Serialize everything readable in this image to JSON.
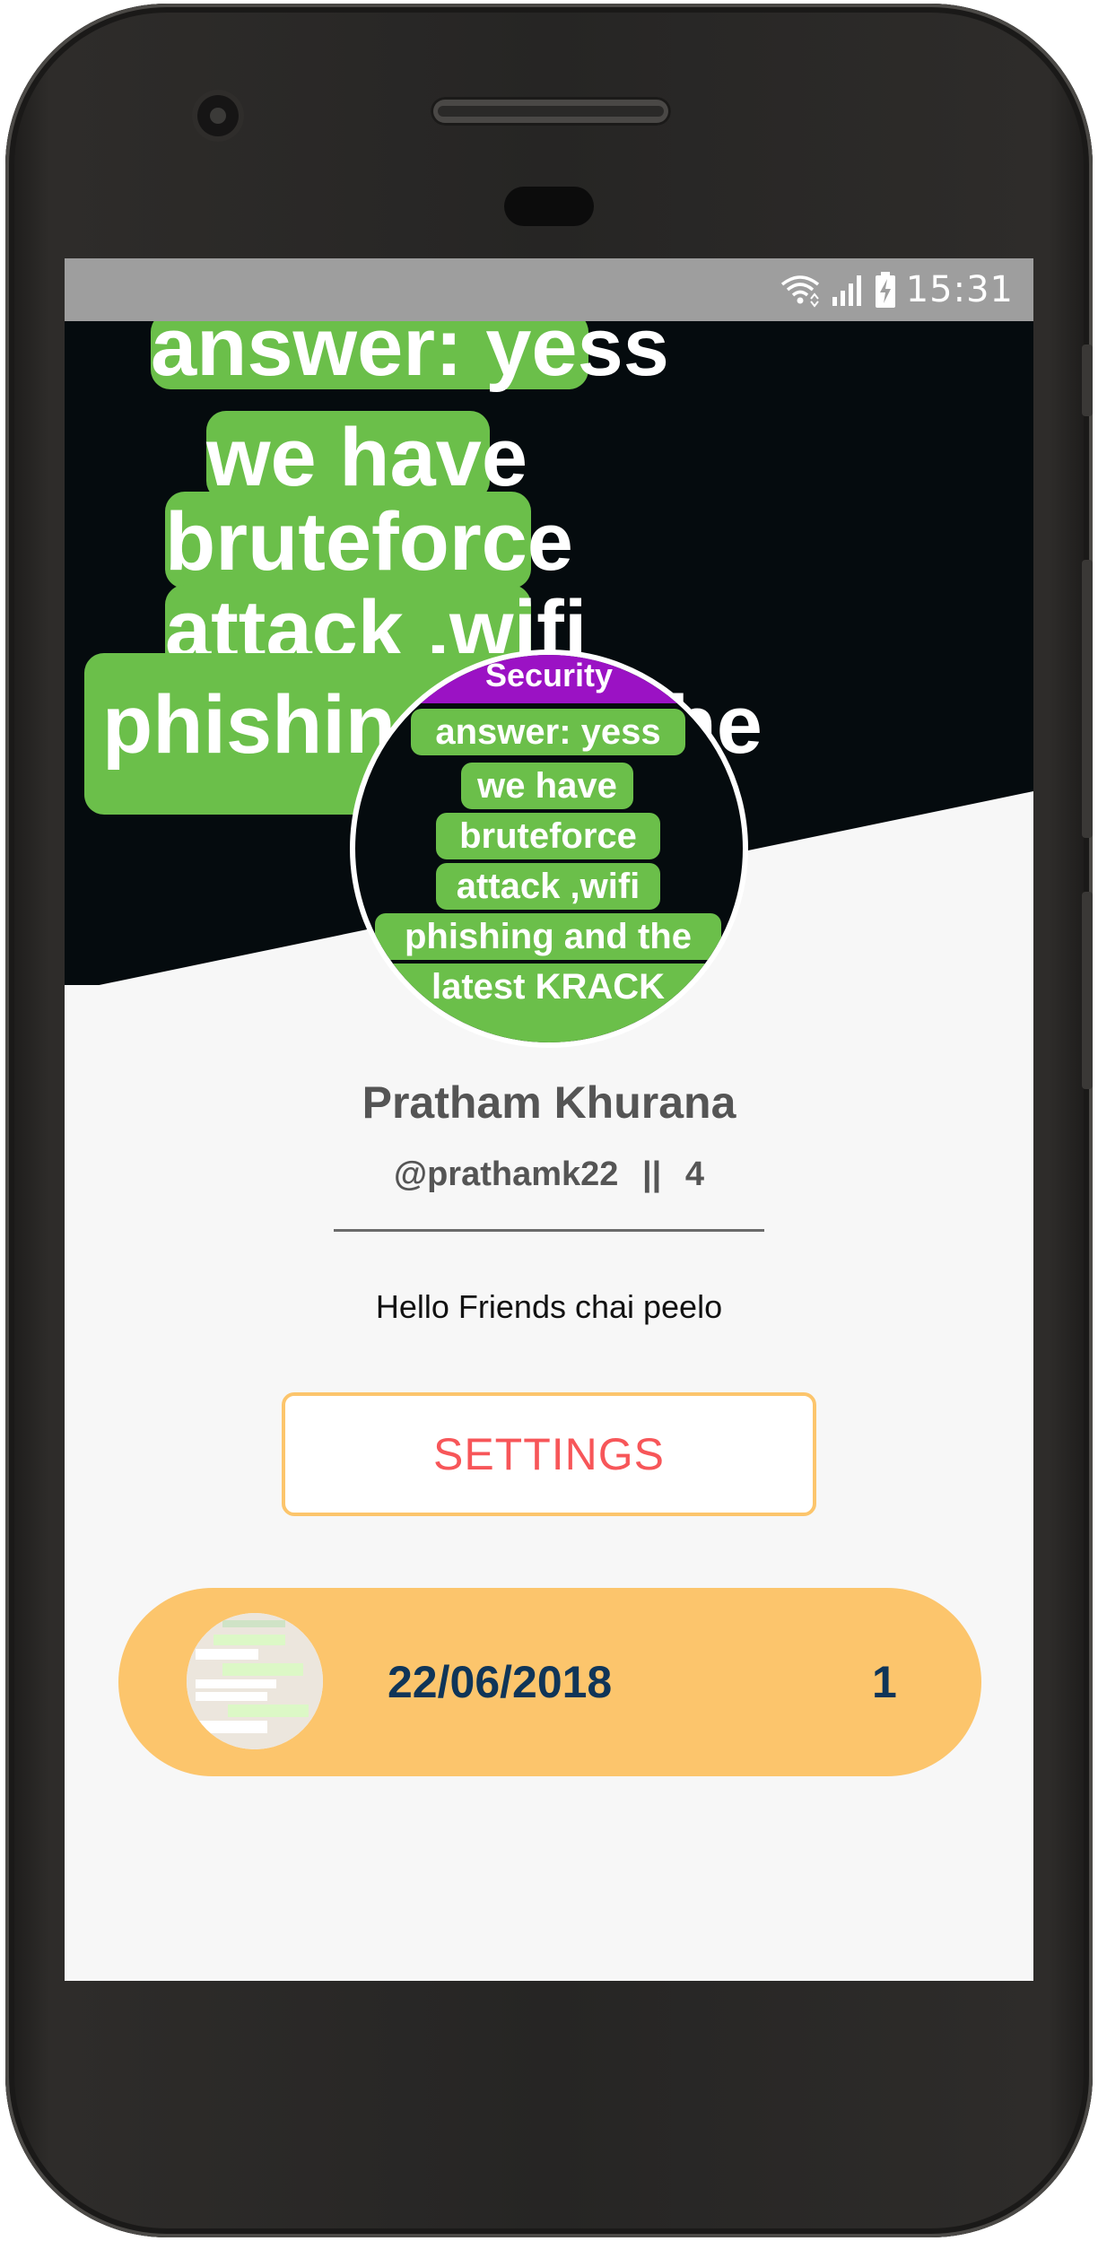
{
  "status_bar": {
    "time": "15:31",
    "icons": [
      "wifi-icon",
      "signal-icon",
      "battery-charging-icon"
    ]
  },
  "cover": {
    "lines": [
      "answer: yess",
      "we have",
      "bruteforce",
      "attack ,wifi",
      "phishing and the"
    ]
  },
  "avatar": {
    "banner": "Security",
    "lines": [
      "answer: yess",
      "we have",
      "bruteforce",
      "attack ,wifi",
      "phishing and the",
      "latest KRACK"
    ]
  },
  "profile": {
    "name": "Pratham Khurana",
    "handle": "@prathamk22",
    "separator": "||",
    "count": "4",
    "bio": "Hello Friends chai peelo"
  },
  "settings_button": {
    "label": "SETTINGS"
  },
  "posts": [
    {
      "date": "22/06/2018",
      "count": "1"
    }
  ],
  "colors": {
    "status_bar": "#9e9e9e",
    "green_pill": "#6bbf4a",
    "accent_orange": "#fcc56c",
    "settings_text": "#f75659",
    "post_text": "#0f3558",
    "background": "#f7f7f7"
  }
}
